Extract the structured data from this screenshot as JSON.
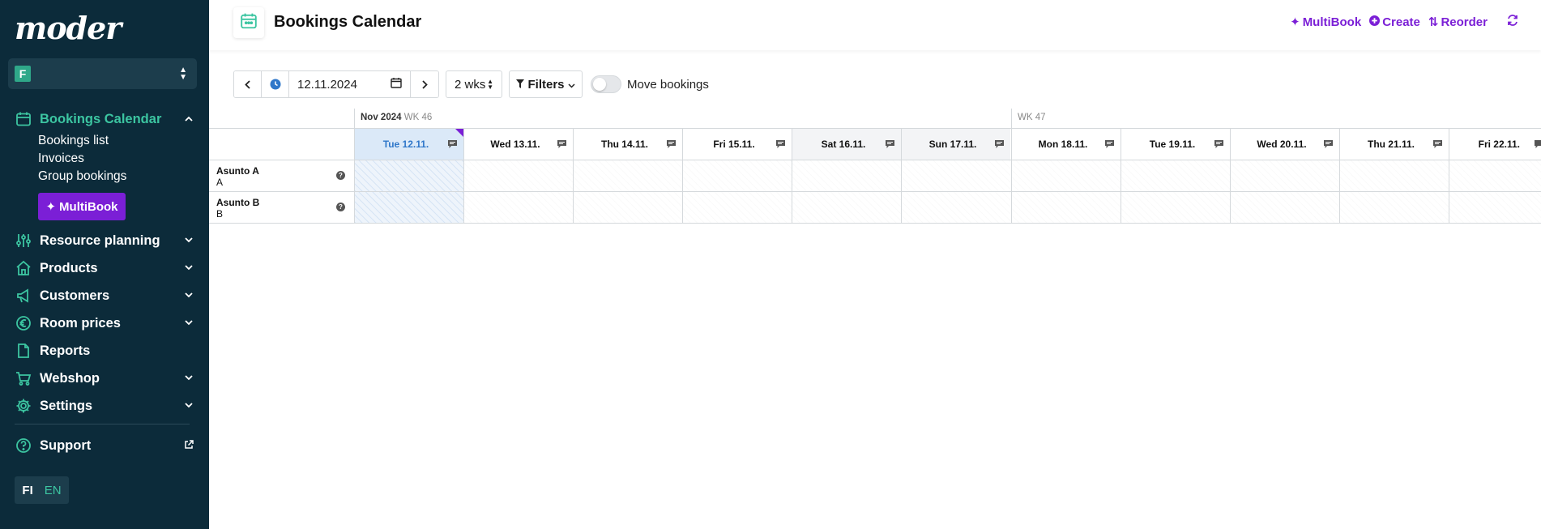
{
  "brand": {
    "logo": "moder",
    "accent": "#7b1fd6",
    "sidebar_bg": "#0c2b3a",
    "active_color": "#3cc5a1"
  },
  "sidebar": {
    "org_initial": "F",
    "nav": [
      {
        "label": "Bookings Calendar",
        "icon": "calendar-icon",
        "expanded": true,
        "active": true
      },
      {
        "label": "Resource planning",
        "icon": "sliders-icon"
      },
      {
        "label": "Products",
        "icon": "home-icon"
      },
      {
        "label": "Customers",
        "icon": "megaphone-icon"
      },
      {
        "label": "Room prices",
        "icon": "euro-icon"
      },
      {
        "label": "Reports",
        "icon": "document-icon"
      },
      {
        "label": "Webshop",
        "icon": "cart-icon"
      },
      {
        "label": "Settings",
        "icon": "gear-icon"
      }
    ],
    "sub_items": [
      "Bookings list",
      "Invoices",
      "Group bookings"
    ],
    "multibook_label": "MultiBook",
    "support_label": "Support",
    "lang": {
      "fi": "FI",
      "en": "EN"
    }
  },
  "header": {
    "title": "Bookings Calendar",
    "actions": {
      "multibook": "MultiBook",
      "create": "Create",
      "reorder": "Reorder"
    }
  },
  "toolbar": {
    "date_value": "12.11.2024",
    "range_value": "2 wks",
    "filters_label": "Filters",
    "move_bookings_label": "Move bookings",
    "move_bookings_on": false
  },
  "calendar": {
    "month_label": "Nov 2024",
    "week_labels": [
      "WK 46",
      "WK 47"
    ],
    "days": [
      {
        "label": "Tue 12.11.",
        "today": true
      },
      {
        "label": "Wed 13.11."
      },
      {
        "label": "Thu 14.11."
      },
      {
        "label": "Fri 15.11."
      },
      {
        "label": "Sat 16.11.",
        "weekend": true
      },
      {
        "label": "Sun 17.11.",
        "weekend": true
      },
      {
        "label": "Mon 18.11."
      },
      {
        "label": "Tue 19.11."
      },
      {
        "label": "Wed 20.11."
      },
      {
        "label": "Thu 21.11."
      },
      {
        "label": "Fri 22.11."
      }
    ],
    "resources": [
      {
        "name": "Asunto A",
        "sub": "A"
      },
      {
        "name": "Asunto B",
        "sub": "B"
      }
    ]
  }
}
